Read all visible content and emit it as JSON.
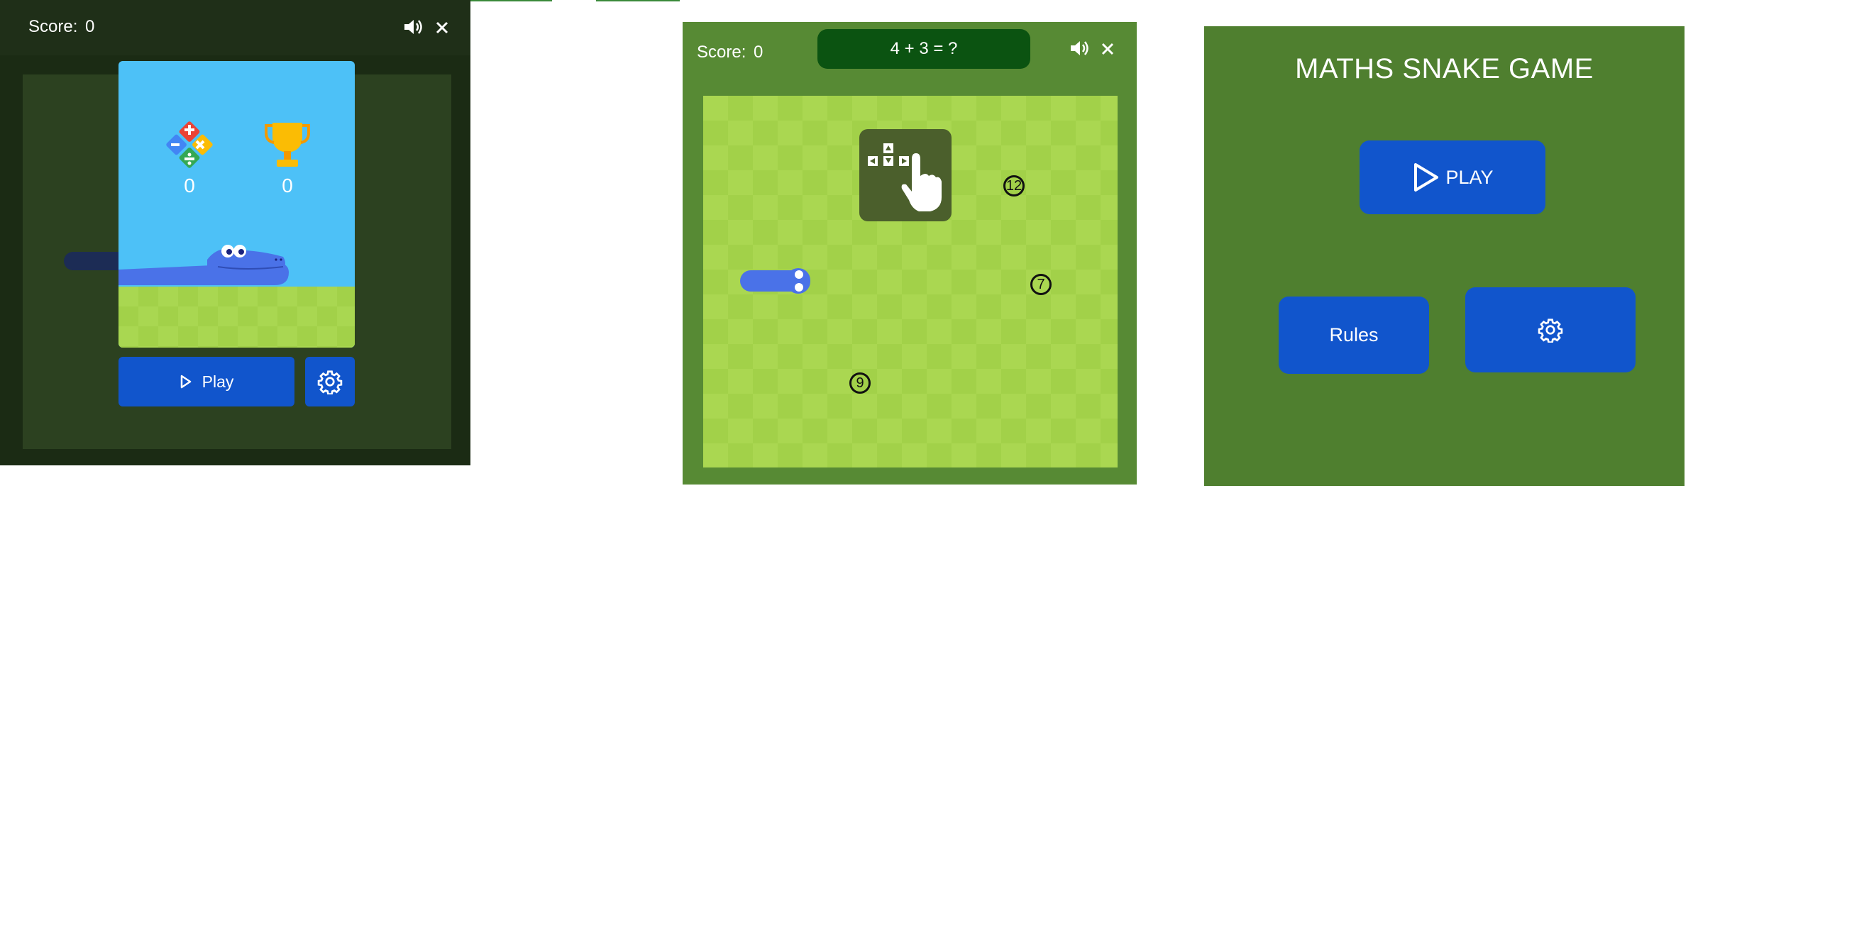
{
  "game_start_screen": {
    "score_label": "Score:",
    "score_value": "0",
    "sound_icon": "speaker-icon",
    "close_icon": "close-icon",
    "stats": [
      {
        "icon": "math-operations-icon",
        "value": "0"
      },
      {
        "icon": "trophy-icon",
        "value": "0"
      }
    ],
    "play_label": "Play",
    "settings_icon": "gear-icon"
  },
  "gameplay_screen": {
    "score_label": "Score:",
    "score_value": "0",
    "question": "4 + 3 = ?",
    "sound_icon": "speaker-icon",
    "close_icon": "close-icon",
    "controls_hint_icon": "arrow-keys-swipe-icon",
    "number_tokens": [
      "12",
      "7",
      "9"
    ]
  },
  "menu_mockup": {
    "title": "MATHS SNAKE GAME",
    "play_label": "PLAY",
    "rules_label": "Rules",
    "settings_icon": "gear-icon"
  },
  "colors": {
    "button_blue": "#1155cc",
    "dark_bg": "#1b2b14",
    "mid_green": "#578a34",
    "grass_light": "#aad751",
    "grass_dark": "#a2d149",
    "question_bg": "#0b5311",
    "snake_blue": "#4a72e8",
    "card_sky": "#4dc1f7"
  }
}
